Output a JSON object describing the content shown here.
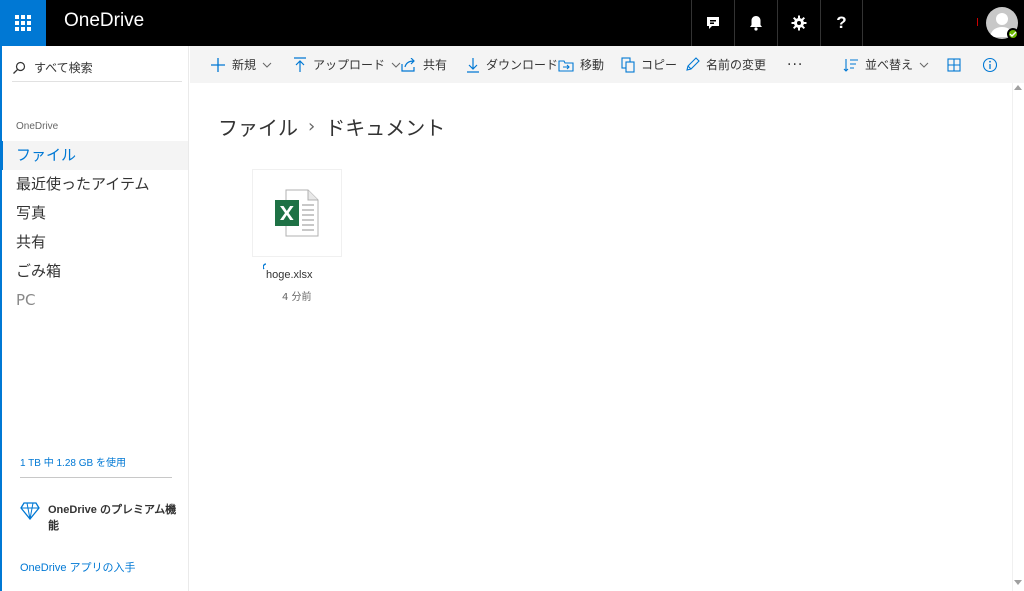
{
  "app": {
    "brand": "OneDrive",
    "accent_color": "#0078d4"
  },
  "topbar": {
    "icons": [
      "feedback-icon",
      "bell-icon",
      "gear-icon",
      "help-icon"
    ],
    "help_label": "?"
  },
  "search": {
    "label": "すべて検索"
  },
  "nav": {
    "heading": "OneDrive",
    "items": [
      {
        "label": "ファイル",
        "active": true
      },
      {
        "label": "最近使ったアイテム"
      },
      {
        "label": "写真"
      },
      {
        "label": "共有"
      },
      {
        "label": "ごみ箱"
      },
      {
        "label": "PC"
      }
    ],
    "storage": "1 TB 中 1.28 GB を使用",
    "premium": "OneDrive のプレミアム機能",
    "get_app": "OneDrive アプリの入手"
  },
  "commands": {
    "new": "新規",
    "upload": "アップロード",
    "share": "共有",
    "download": "ダウンロード",
    "move": "移動",
    "copy": "コピー",
    "rename": "名前の変更",
    "more": "···",
    "sort": "並べ替え"
  },
  "breadcrumb": {
    "root": "ファイル",
    "separator": "›",
    "current": "ドキュメント"
  },
  "files": [
    {
      "name": "hoge.xlsx",
      "modified": "4 分前",
      "icon": "excel-file-icon"
    }
  ]
}
